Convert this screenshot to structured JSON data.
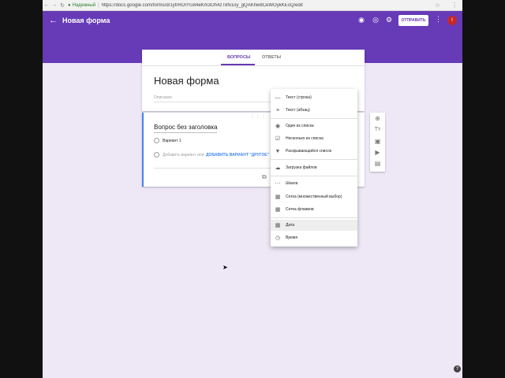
{
  "browser": {
    "secure_label": "Надежный",
    "url": "https://docs.google.com/forms/d/1ytrROIYG84eKm3Oh4zT8N1oy_gQAKhw8CeWOykKEsQ/edit"
  },
  "appbar": {
    "title": "Новая форма",
    "send_label": "ОТПРАВИТЬ",
    "avatar_letter": "I"
  },
  "tabs": [
    {
      "label": "ВОПРОСЫ"
    },
    {
      "label": "ОТВЕТЫ"
    }
  ],
  "form": {
    "title": "Новая форма",
    "description_placeholder": "Описание"
  },
  "question": {
    "title": "Вопрос без заголовка",
    "option_1": "Вариант 1",
    "add_option": "Добавить вариант",
    "or_label": "или",
    "add_other": "ДОБАВИТЬ ВАРИАНТ \"ДРУГОЕ\""
  },
  "dropdown": {
    "items": [
      {
        "label": "Текст (строка)",
        "icon": "short-text-icon"
      },
      {
        "label": "Текст (абзац)",
        "icon": "paragraph-icon"
      },
      {
        "label": "Один из списка",
        "icon": "radio-icon"
      },
      {
        "label": "Несколько из списка",
        "icon": "checkbox-icon"
      },
      {
        "label": "Раскрывающийся список",
        "icon": "dropdown-icon"
      },
      {
        "label": "Загрузка файлов",
        "icon": "cloud-upload-icon"
      },
      {
        "label": "Шкала",
        "icon": "linear-scale-icon"
      },
      {
        "label": "Сетка (множественный выбор)",
        "icon": "grid-icon"
      },
      {
        "label": "Сетка флажков",
        "icon": "grid-icon"
      },
      {
        "label": "Дата",
        "icon": "calendar-icon"
      },
      {
        "label": "Время",
        "icon": "clock-icon"
      }
    ]
  },
  "colors": {
    "accent": "#673ab7",
    "background": "#ede7f6",
    "link": "#4285f4"
  }
}
